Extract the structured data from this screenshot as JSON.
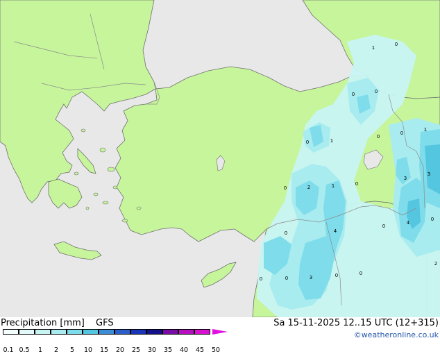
{
  "footer": {
    "title_left": "Precipitation [mm]",
    "title_model": "GFS",
    "title_right": "Sa 15-11-2025 12..15 UTC (12+315)",
    "credit": "©weatheronline.co.uk"
  },
  "legend": {
    "labels": [
      "0.1",
      "0.5",
      "1",
      "2",
      "5",
      "10",
      "15",
      "20",
      "25",
      "30",
      "35",
      "40",
      "45",
      "50"
    ],
    "colors": [
      "#f6fdfd",
      "#e3fafa",
      "#c9f4f4",
      "#a8ecf0",
      "#7fdcea",
      "#55c6e0",
      "#3d8cd6",
      "#2a5ec8",
      "#1a34b8",
      "#14108a",
      "#7a0ca6",
      "#b410c0",
      "#d810d0",
      "#e020e0"
    ]
  },
  "map": {
    "colors": {
      "sea": "#e8e8e8",
      "land": "#c6f59b",
      "border": "#8c8c8c",
      "coast": "#707070"
    },
    "values": [
      "1",
      "0",
      "0",
      "0",
      "0",
      "0",
      "0",
      "1",
      "0",
      "2",
      "1",
      "0",
      "3",
      "3",
      "0",
      "4",
      "0",
      "4",
      "0",
      "0",
      "3",
      "0",
      "0",
      "0",
      "2"
    ]
  }
}
